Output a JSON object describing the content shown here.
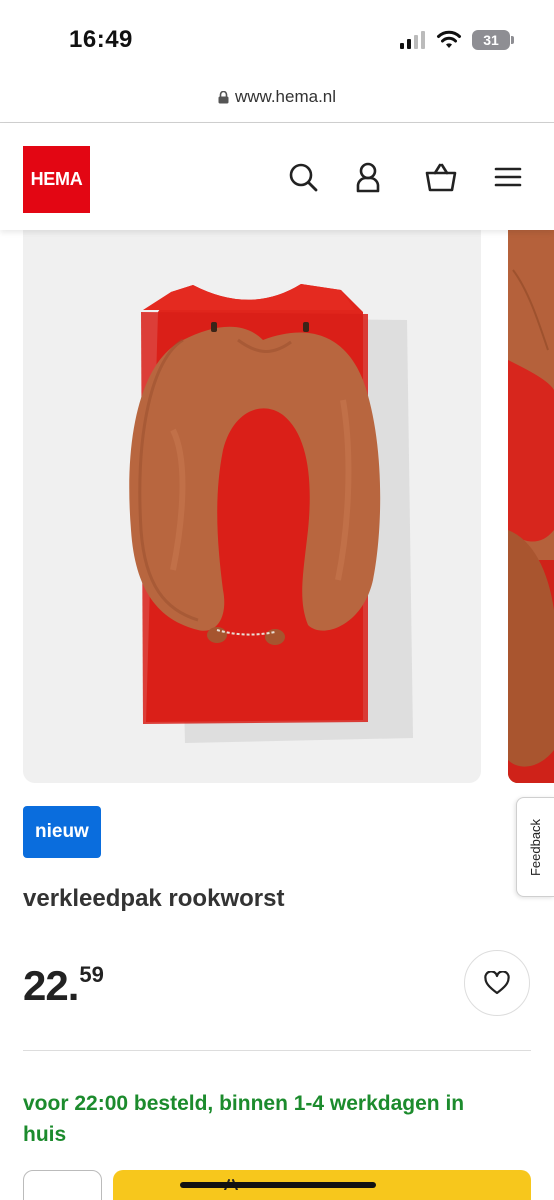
{
  "status_bar": {
    "time": "16:49",
    "battery": "31"
  },
  "browser": {
    "url": "www.hema.nl"
  },
  "header": {
    "logo_text": "HEMA",
    "icons": [
      "search-icon",
      "account-icon",
      "basket-icon",
      "menu-icon"
    ]
  },
  "product": {
    "badge": "nieuw",
    "title": "verkleedpak rookworst",
    "price_int": "22",
    "price_sep": ".",
    "price_dec": "59",
    "delivery": "voor 22:00 besteld, binnen 1-4 werkdagen in huis"
  },
  "feedback_label": "Feedback",
  "colors": {
    "brand_red": "#e30613",
    "badge_blue": "#0a6ddd",
    "delivery_green": "#1c8b2d",
    "cta_yellow": "#f7c71c"
  }
}
